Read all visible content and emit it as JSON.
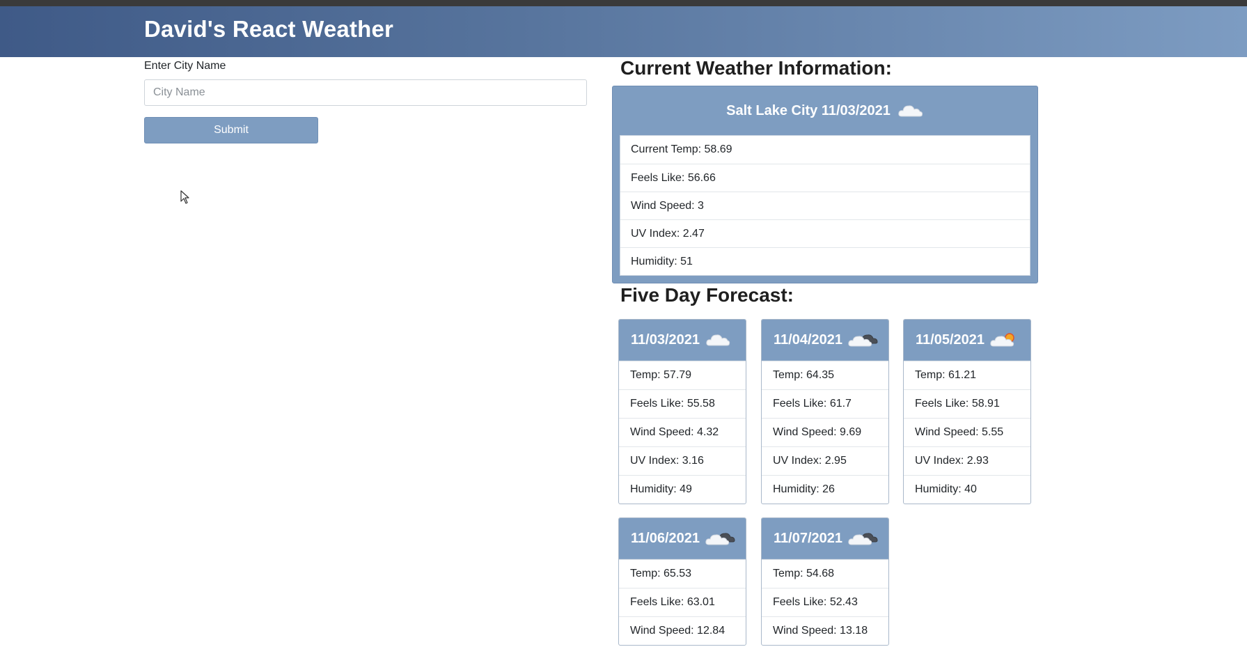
{
  "app": {
    "title": "David's React Weather"
  },
  "form": {
    "label": "Enter City Name",
    "placeholder": "City Name",
    "value": "",
    "submit_label": "Submit"
  },
  "current": {
    "section_title": "Current Weather Information:",
    "heading": "Salt Lake City 11/03/2021",
    "icon": "cloud-icon",
    "items": [
      "Current Temp: 58.69",
      "Feels Like: 56.66",
      "Wind Speed: 3",
      "UV Index: 2.47",
      "Humidity: 51"
    ]
  },
  "forecast": {
    "section_title": "Five Day Forecast:",
    "days": [
      {
        "date": "11/03/2021",
        "icon": "cloud-icon",
        "items": [
          "Temp: 57.79",
          "Feels Like: 55.58",
          "Wind Speed: 4.32",
          "UV Index: 3.16",
          "Humidity: 49"
        ]
      },
      {
        "date": "11/04/2021",
        "icon": "dark-clouds-icon",
        "items": [
          "Temp: 64.35",
          "Feels Like: 61.7",
          "Wind Speed: 9.69",
          "UV Index: 2.95",
          "Humidity: 26"
        ]
      },
      {
        "date": "11/05/2021",
        "icon": "partly-sunny-icon",
        "items": [
          "Temp: 61.21",
          "Feels Like: 58.91",
          "Wind Speed: 5.55",
          "UV Index: 2.93",
          "Humidity: 40"
        ]
      },
      {
        "date": "11/06/2021",
        "icon": "dark-clouds-icon",
        "items": [
          "Temp: 65.53",
          "Feels Like: 63.01",
          "Wind Speed: 12.84"
        ]
      },
      {
        "date": "11/07/2021",
        "icon": "dark-clouds-icon",
        "items": [
          "Temp: 54.68",
          "Feels Like: 52.43",
          "Wind Speed: 13.18"
        ]
      }
    ]
  },
  "colors": {
    "accent": "#7e9dc1",
    "header_start": "#3f5a87",
    "header_end": "#7d9cc2"
  }
}
